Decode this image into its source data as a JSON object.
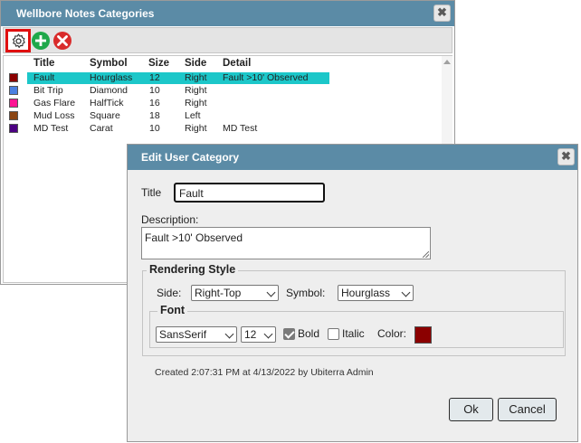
{
  "categories_window": {
    "title": "Wellbore Notes Categories",
    "close_glyph": "✖",
    "toolbar": {
      "icons": [
        "gear-icon",
        "plus-circle-icon",
        "x-circle-icon"
      ]
    },
    "columns": [
      "Title",
      "Symbol",
      "Size",
      "Side",
      "Detail"
    ],
    "rows": [
      {
        "color": "#8b0000",
        "title": "Fault",
        "symbol": "Hourglass",
        "size": "12",
        "side": "Right",
        "detail": "Fault >10' Observed",
        "selected": true
      },
      {
        "color": "#4a7fe0",
        "title": "Bit Trip",
        "symbol": "Diamond",
        "size": "10",
        "side": "Right",
        "detail": ""
      },
      {
        "color": "#ff1493",
        "title": "Gas Flare",
        "symbol": "HalfTick",
        "size": "16",
        "side": "Right",
        "detail": ""
      },
      {
        "color": "#8b4513",
        "title": "Mud Loss",
        "symbol": "Square",
        "size": "18",
        "side": "Left",
        "detail": ""
      },
      {
        "color": "#4b0082",
        "title": "MD Test",
        "symbol": "Carat",
        "size": "10",
        "side": "Right",
        "detail": "MD Test"
      }
    ]
  },
  "edit_dialog": {
    "title": "Edit User Category",
    "close_glyph": "✖",
    "title_label": "Title",
    "title_value": "Fault",
    "description_label": "Description:",
    "description_value": "Fault >10' Observed",
    "rendering_style": {
      "legend": "Rendering Style",
      "side_label": "Side:",
      "side_value": "Right-Top",
      "symbol_label": "Symbol:",
      "symbol_value": "Hourglass"
    },
    "font": {
      "legend": "Font",
      "family_value": "SansSerif",
      "size_value": "12",
      "bold_label": "Bold",
      "bold_checked": true,
      "italic_label": "Italic",
      "italic_checked": false,
      "color_label": "Color:",
      "color_value": "#8b0000"
    },
    "created_text": "Created 2:07:31 PM at 4/13/2022 by Ubiterra Admin",
    "ok_label": "Ok",
    "cancel_label": "Cancel"
  },
  "colors": {
    "titlebar": "#5b8ba6",
    "selection": "#1cc7c9",
    "add_green": "#1fa84a",
    "delete_red": "#d92b2b"
  }
}
